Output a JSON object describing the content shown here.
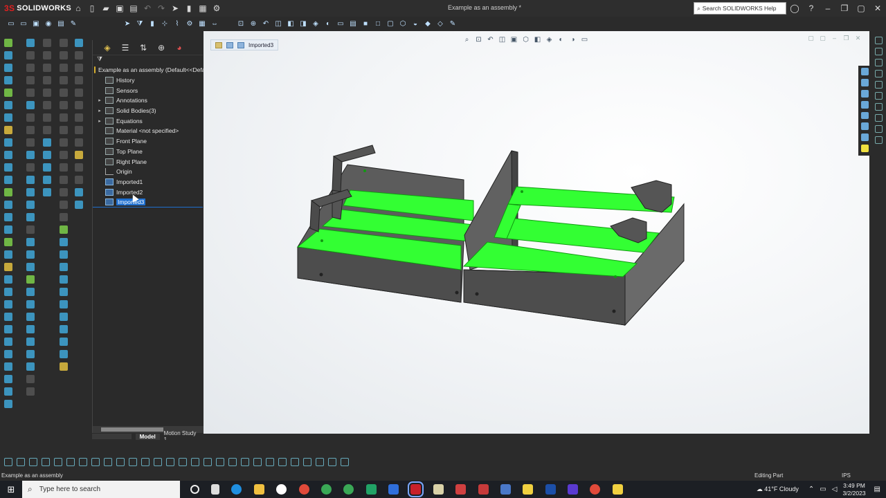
{
  "app": {
    "brand": "SOLIDWORKS",
    "window_title": "Example as an assembly *"
  },
  "search": {
    "placeholder": "Search SOLIDWORKS Help"
  },
  "feature_tree": {
    "root": "Example as an assembly  (Default<<Defa",
    "items": [
      {
        "label": "History",
        "expandable": false,
        "icon": "history-icon"
      },
      {
        "label": "Sensors",
        "expandable": false,
        "icon": "sensors-icon"
      },
      {
        "label": "Annotations",
        "expandable": true,
        "icon": "annotations-icon"
      },
      {
        "label": "Solid Bodies(3)",
        "expandable": true,
        "icon": "solid-bodies-icon"
      },
      {
        "label": "Equations",
        "expandable": true,
        "icon": "equations-icon"
      },
      {
        "label": "Material <not specified>",
        "expandable": false,
        "icon": "material-icon"
      },
      {
        "label": "Front Plane",
        "expandable": false,
        "icon": "plane-icon"
      },
      {
        "label": "Top Plane",
        "expandable": false,
        "icon": "plane-icon"
      },
      {
        "label": "Right Plane",
        "expandable": false,
        "icon": "plane-icon"
      },
      {
        "label": "Origin",
        "expandable": false,
        "icon": "origin-icon"
      },
      {
        "label": "Imported1",
        "expandable": false,
        "icon": "imported-body-icon"
      },
      {
        "label": "Imported2",
        "expandable": false,
        "icon": "imported-body-icon"
      },
      {
        "label": "Imported3",
        "expandable": false,
        "icon": "imported-body-icon",
        "selected": true
      }
    ]
  },
  "breadcrumb": {
    "current": "Imported3"
  },
  "bottom_tabs": {
    "model": "Model",
    "motion": "Motion Study 1"
  },
  "status": {
    "left": "Example as an assembly",
    "middle": "Editing Part",
    "units": "IPS"
  },
  "taskbar": {
    "search_placeholder": "Type here to search",
    "weather": "41°F  Cloudy",
    "time": "3:49 PM",
    "date": "3/2/2023"
  },
  "colors": {
    "highlight_green": "#33ff33",
    "selection_blue": "#1e6fd0",
    "part_gray": "#5a5a5a"
  }
}
